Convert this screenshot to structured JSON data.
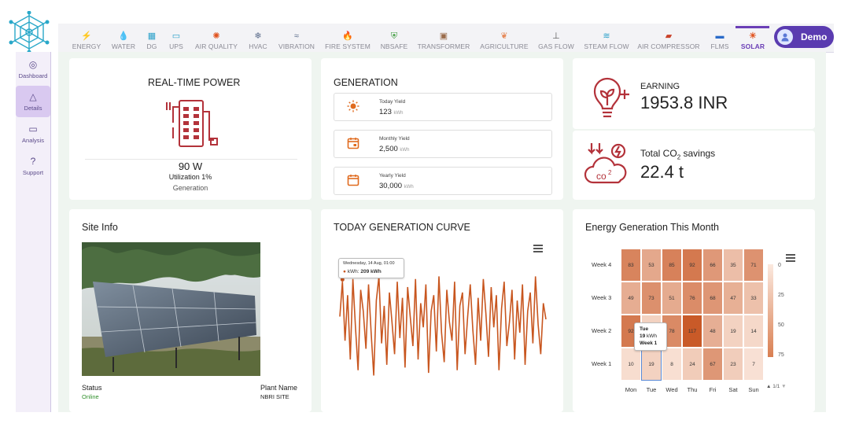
{
  "nav": {
    "items": [
      {
        "label": "ENERGY",
        "icon": "bolt-icon",
        "glyph": "⚡"
      },
      {
        "label": "WATER",
        "icon": "water-drop-icon",
        "glyph": "💧"
      },
      {
        "label": "DG",
        "icon": "generator-icon",
        "glyph": "▦"
      },
      {
        "label": "UPS",
        "icon": "battery-icon",
        "glyph": "▭"
      },
      {
        "label": "AIR QUALITY",
        "icon": "air-icon",
        "glyph": "✺"
      },
      {
        "label": "HVAC",
        "icon": "hvac-icon",
        "glyph": "❄"
      },
      {
        "label": "VIBRATION",
        "icon": "vibration-icon",
        "glyph": "≈"
      },
      {
        "label": "FIRE SYSTEM",
        "icon": "fire-icon",
        "glyph": "🔥"
      },
      {
        "label": "NBSAFE",
        "icon": "shield-icon",
        "glyph": "⛨"
      },
      {
        "label": "TRANSFORMER",
        "icon": "transformer-icon",
        "glyph": "▣"
      },
      {
        "label": "AGRICULTURE",
        "icon": "leaf-icon",
        "glyph": "❦"
      },
      {
        "label": "GAS FLOW",
        "icon": "gas-flow-icon",
        "glyph": "⊥"
      },
      {
        "label": "STEAM FLOW",
        "icon": "steam-icon",
        "glyph": "≋"
      },
      {
        "label": "AIR COMPRESSOR",
        "icon": "compressor-icon",
        "glyph": "▰"
      },
      {
        "label": "FLMS",
        "icon": "truck-icon",
        "glyph": "▬"
      },
      {
        "label": "SOLAR",
        "icon": "solar-icon",
        "glyph": "☀"
      }
    ],
    "active": "SOLAR",
    "user": "Demo"
  },
  "sidebar": {
    "items": [
      {
        "label": "Dashboard",
        "icon": "gauge-icon",
        "glyph": "◎"
      },
      {
        "label": "Details",
        "icon": "warning-icon",
        "glyph": "△"
      },
      {
        "label": "Analysis",
        "icon": "monitor-icon",
        "glyph": "▭"
      },
      {
        "label": "Support",
        "icon": "help-icon",
        "glyph": "?"
      }
    ],
    "active": "Details"
  },
  "realtime": {
    "title": "REAL-TIME POWER",
    "power": "90 W",
    "utilization": "Utilization 1%",
    "label": "Generation"
  },
  "generation": {
    "title": "GENERATION",
    "rows": [
      {
        "label": "Today Yield",
        "value": "123",
        "unit": "kWh",
        "icon": "sun-icon"
      },
      {
        "label": "Monthly Yield",
        "value": "2,500",
        "unit": "kWh",
        "icon": "calendar-icon"
      },
      {
        "label": "Yearly Yield",
        "value": "30,000",
        "unit": "kWh",
        "icon": "calendar-icon"
      }
    ]
  },
  "earning": {
    "label": "EARNING",
    "value": "1953.8 INR"
  },
  "co2": {
    "label_prefix": "Total CO",
    "label_sub": "2",
    "label_suffix": " savings",
    "value": "22.4 t"
  },
  "site": {
    "title": "Site Info",
    "status_label": "Status",
    "status_value": "Online",
    "plant_label": "Plant Name",
    "plant_value": "NBRI SITE"
  },
  "curve": {
    "title": "TODAY GENERATION CURVE",
    "tooltip_date": "Wednesday, 14 Aug, 01:00",
    "tooltip_series": "kWh:",
    "tooltip_value": "209 kWh",
    "color": "#c8561f"
  },
  "heatmap": {
    "title": "Energy Generation This Month",
    "tooltip_day": "Tue",
    "tooltip_value": "19",
    "tooltip_unit": "kWh",
    "tooltip_week": "Week 1",
    "pager": "1/1"
  },
  "chart_data": [
    {
      "type": "line",
      "title": "TODAY GENERATION CURVE",
      "series": [
        {
          "values": [
            140,
            205,
            95,
            180,
            60,
            210,
            120,
            40,
            190,
            150,
            80,
            200,
            110,
            30,
            170,
            215,
            90,
            160,
            50,
            185,
            130,
            70,
            205,
            100,
            175,
            45,
            195,
            140,
            85,
            210,
            60,
            165,
            120,
            200,
            35,
            150,
            180,
            75,
            215,
            110,
            55,
            190,
            130,
            95,
            205,
            40,
            160,
            185,
            70,
            140,
            200,
            115,
            50,
            175,
            95,
            210,
            145,
            65,
            195,
            120,
            180,
            40,
            155,
            205,
            85,
            130,
            190,
            60,
            170,
            110,
            200,
            50,
            150,
            185,
            90,
            215,
            125,
            70,
            165,
            135
          ]
        }
      ],
      "highlight": {
        "x": "Wednesday, 14 Aug, 01:00",
        "y": 209
      }
    },
    {
      "type": "heatmap",
      "title": "Energy Generation This Month",
      "x": [
        "Mon",
        "Tue",
        "Wed",
        "Thu",
        "Fri",
        "Sat",
        "Sun"
      ],
      "y": [
        "Week 4",
        "Week 3",
        "Week 2",
        "Week 1"
      ],
      "values": [
        [
          83,
          53,
          85,
          92,
          66,
          35,
          71
        ],
        [
          49,
          73,
          51,
          76,
          68,
          47,
          33
        ],
        [
          92,
          19,
          78,
          117,
          48,
          19,
          14
        ],
        [
          10,
          19,
          8,
          24,
          67,
          23,
          7
        ]
      ],
      "colorbar_ticks": [
        0,
        25,
        50,
        75
      ]
    }
  ]
}
